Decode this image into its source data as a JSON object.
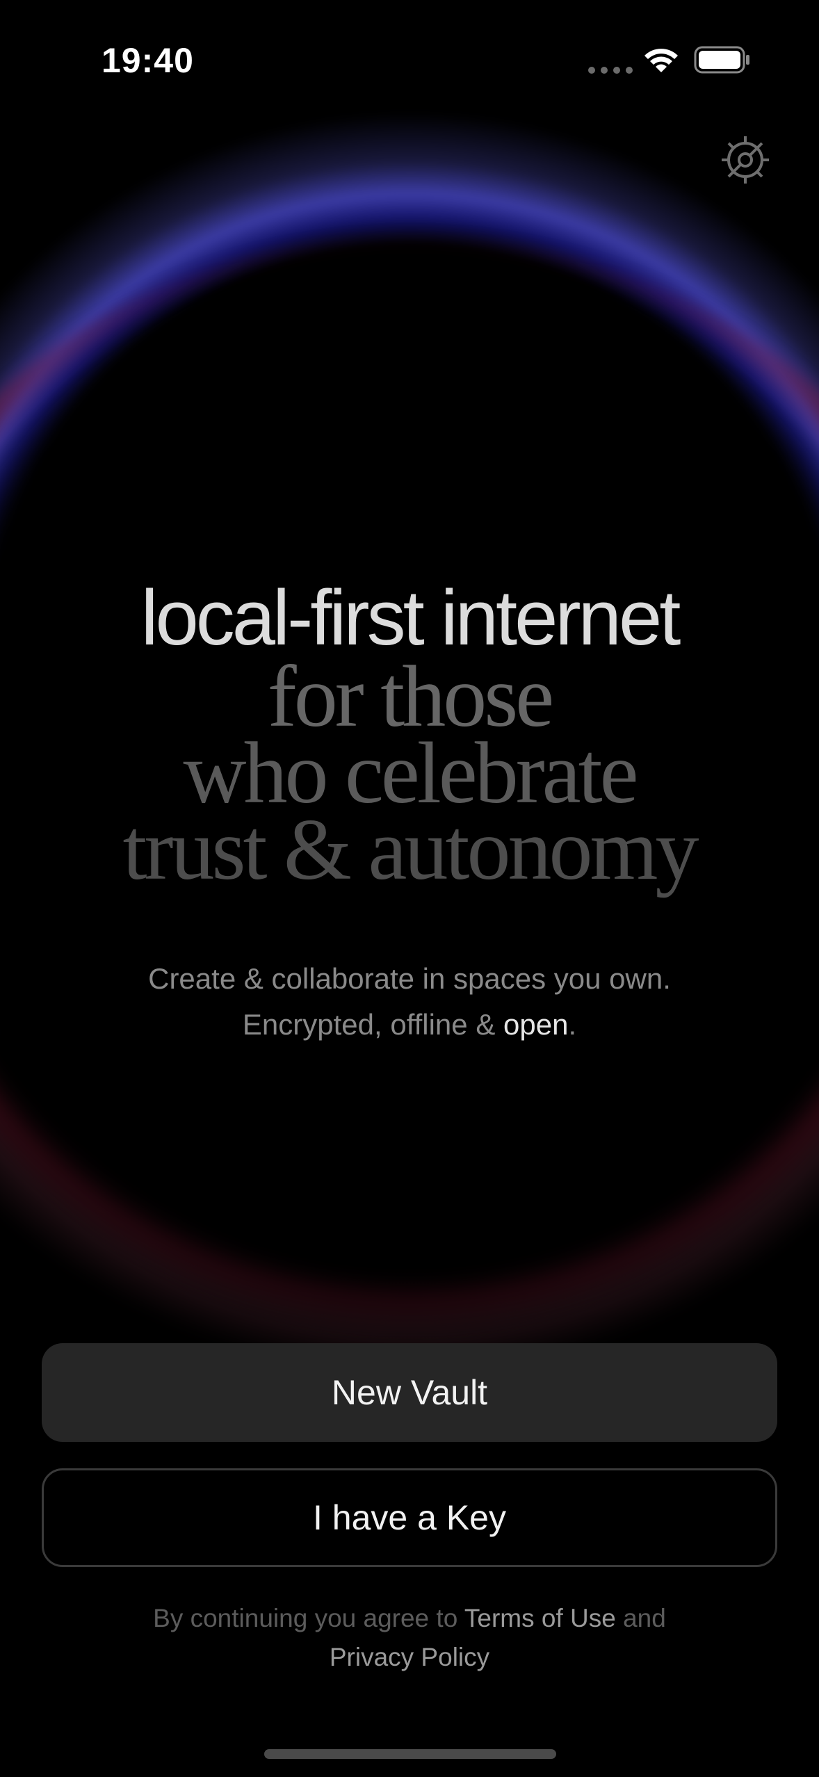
{
  "status_bar": {
    "time": "19:40"
  },
  "icons": {
    "settings": "gear-icon",
    "wifi": "wifi-icon",
    "battery": "battery-icon"
  },
  "hero": {
    "line1": "local-first internet",
    "line2": "for those",
    "line3": "who celebrate",
    "line4": "trust & autonomy"
  },
  "subtitle": {
    "line1": "Create & collaborate in spaces you own.",
    "line2_prefix": "Encrypted, offline & ",
    "line2_highlight": "open",
    "line2_suffix": "."
  },
  "actions": {
    "new_vault_label": "New Vault",
    "have_key_label": "I have a Key"
  },
  "legal": {
    "prefix": "By continuing you agree to ",
    "terms_label": "Terms of Use",
    "middle": " and",
    "privacy_label": "Privacy Policy"
  },
  "colors": {
    "background": "#000000",
    "glow_top": "#4b4bd2",
    "glow_bottom": "#7a1a30",
    "primary_button": "#262626"
  }
}
